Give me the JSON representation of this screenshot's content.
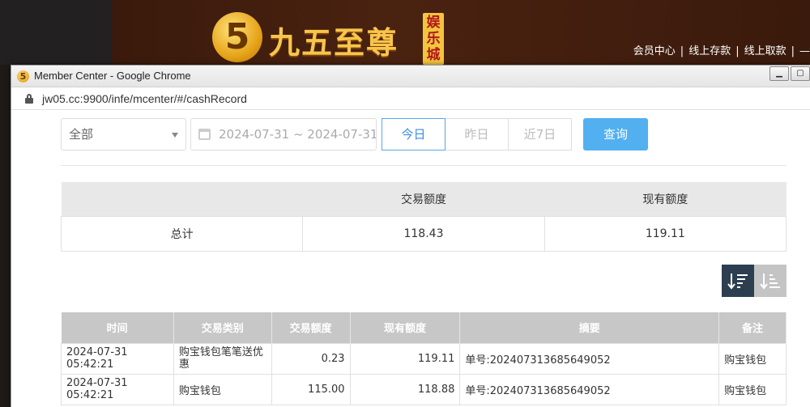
{
  "site": {
    "logo_char": "5",
    "logo_text": "九五至尊",
    "logo_badge": "娱乐城",
    "top_links": [
      "会员中心",
      "线上存款",
      "线上取款",
      "—"
    ],
    "separator": "|"
  },
  "window": {
    "title": "Member Center - Google Chrome",
    "url": "jw05.cc:9900/infe/mcenter/#/cashRecord",
    "min_glyph": "▁",
    "max_glyph": "▢"
  },
  "filters": {
    "type_value": "全部",
    "date_range": "2024-07-31 ~ 2024-07-31",
    "quick_buttons": [
      "今日",
      "昨日",
      "近7日"
    ],
    "active_quick": "今日",
    "query_label": "查询"
  },
  "summary": {
    "headers": [
      "",
      "交易额度",
      "现有额度"
    ],
    "row": [
      "总计",
      "118.43",
      "119.11"
    ]
  },
  "detail": {
    "headers": [
      "时间",
      "交易类别",
      "交易额度",
      "现有额度",
      "摘要",
      "备注"
    ],
    "rows": [
      [
        "2024-07-31 05:42:21",
        "购宝钱包笔笔送优惠",
        "0.23",
        "119.11",
        "单号:202407313685649052",
        "购宝钱包"
      ],
      [
        "2024-07-31 05:42:21",
        "购宝钱包",
        "115.00",
        "118.88",
        "单号:202407313685649052",
        "购宝钱包"
      ]
    ]
  },
  "colors": {
    "query_button": "#52b0f0",
    "active_border": "#5aa7e8",
    "sort_active": "#2c3e50",
    "table_header": "#c7c7c7"
  }
}
